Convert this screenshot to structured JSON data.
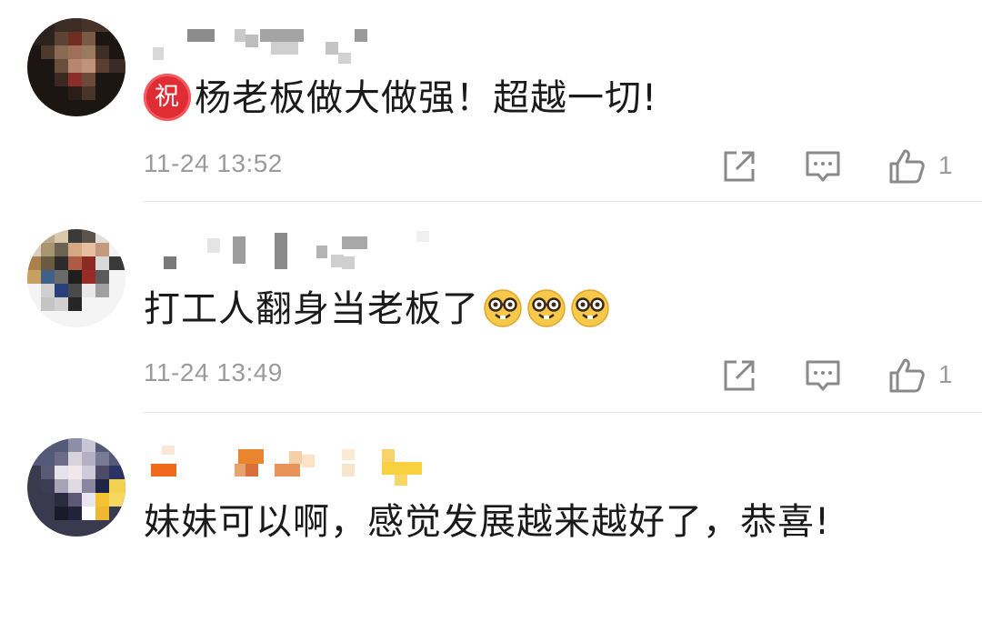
{
  "comments": [
    {
      "badge": "祝",
      "text": "杨老板做大做强！超越一切!",
      "timestamp": "11-24 13:52",
      "likes": "1",
      "icons": [
        "share-icon",
        "comment-icon",
        "like-icon"
      ]
    },
    {
      "text": "打工人翻身当老板了",
      "emoji": [
        "nerd-face-emoji",
        "nerd-face-emoji",
        "nerd-face-emoji"
      ],
      "timestamp": "11-24 13:49",
      "likes": "1",
      "icons": [
        "share-icon",
        "comment-icon",
        "like-icon"
      ]
    },
    {
      "text": "妹妹可以啊，感觉发展越来越好了，恭喜!"
    }
  ],
  "colors": {
    "badge": "#e02c33",
    "text": "#1a1a1a",
    "meta": "#9b9b9b",
    "divider": "#e8e8e8"
  }
}
